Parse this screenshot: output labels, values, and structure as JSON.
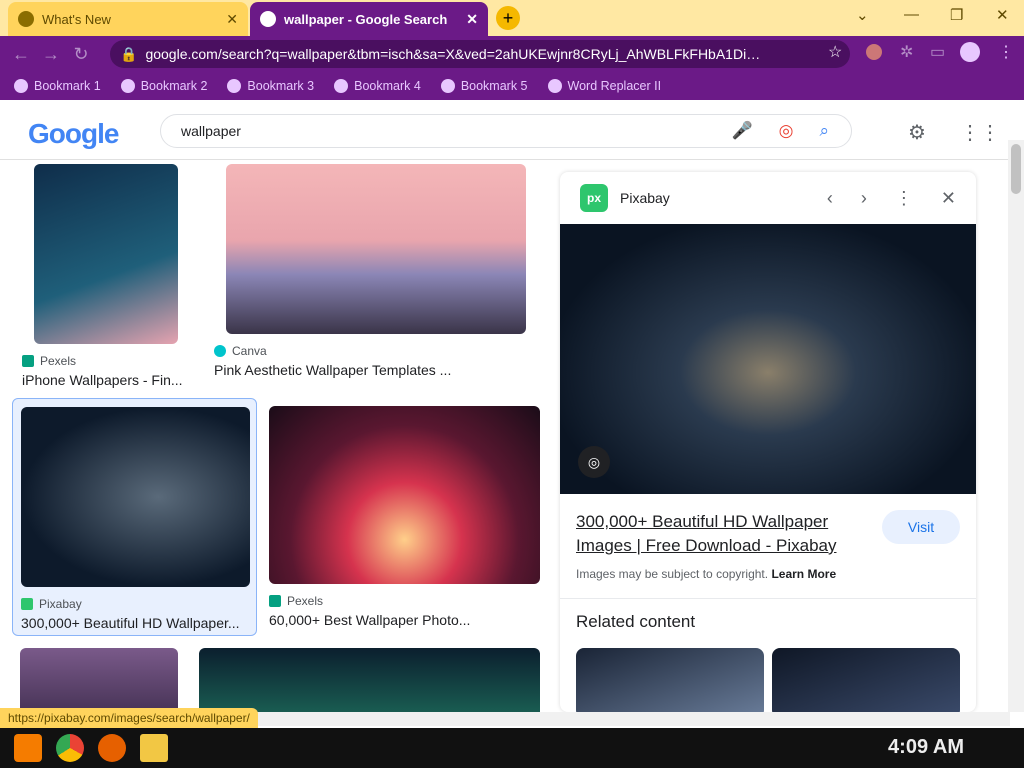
{
  "tabs": [
    {
      "title": "What's New",
      "active": false
    },
    {
      "title": "wallpaper - Google Search",
      "active": true
    }
  ],
  "address": {
    "url": "google.com/search?q=wallpaper&tbm=isch&sa=X&ved=2ahUKEwjnr8CRyLj_AhWBLFkFHbA1DiM..."
  },
  "bookmarks": [
    {
      "label": "Bookmark 1"
    },
    {
      "label": "Bookmark 2"
    },
    {
      "label": "Bookmark 3"
    },
    {
      "label": "Bookmark 4"
    },
    {
      "label": "Bookmark 5"
    },
    {
      "label": "Word Replacer II"
    }
  ],
  "search": {
    "query": "wallpaper"
  },
  "logo": {
    "text": "Google"
  },
  "results": [
    {
      "source": "Pexels",
      "caption": "iPhone Wallpapers - Fin..."
    },
    {
      "source": "Canva",
      "caption": "Pink Aesthetic Wallpaper Templates ..."
    },
    {
      "source": "Pixabay",
      "caption": "300,000+ Beautiful HD Wallpaper..."
    },
    {
      "source": "Pexels",
      "caption": "60,000+ Best   Wallpaper Photo..."
    }
  ],
  "panel": {
    "site": "Pixabay",
    "logo": "px",
    "title": "300,000+ Beautiful HD Wallpaper Images | Free Download - Pixabay",
    "visit": "Visit",
    "copyright": "Images may be subject to copyright.",
    "learn_more": "Learn More",
    "related": "Related content"
  },
  "status": {
    "url": "https://pixabay.com/images/search/wallpaper/"
  },
  "clock": {
    "time": "4:09 AM"
  },
  "colors": {
    "accent": "#6b1a87",
    "tab_bg": "#ffe8a3"
  }
}
